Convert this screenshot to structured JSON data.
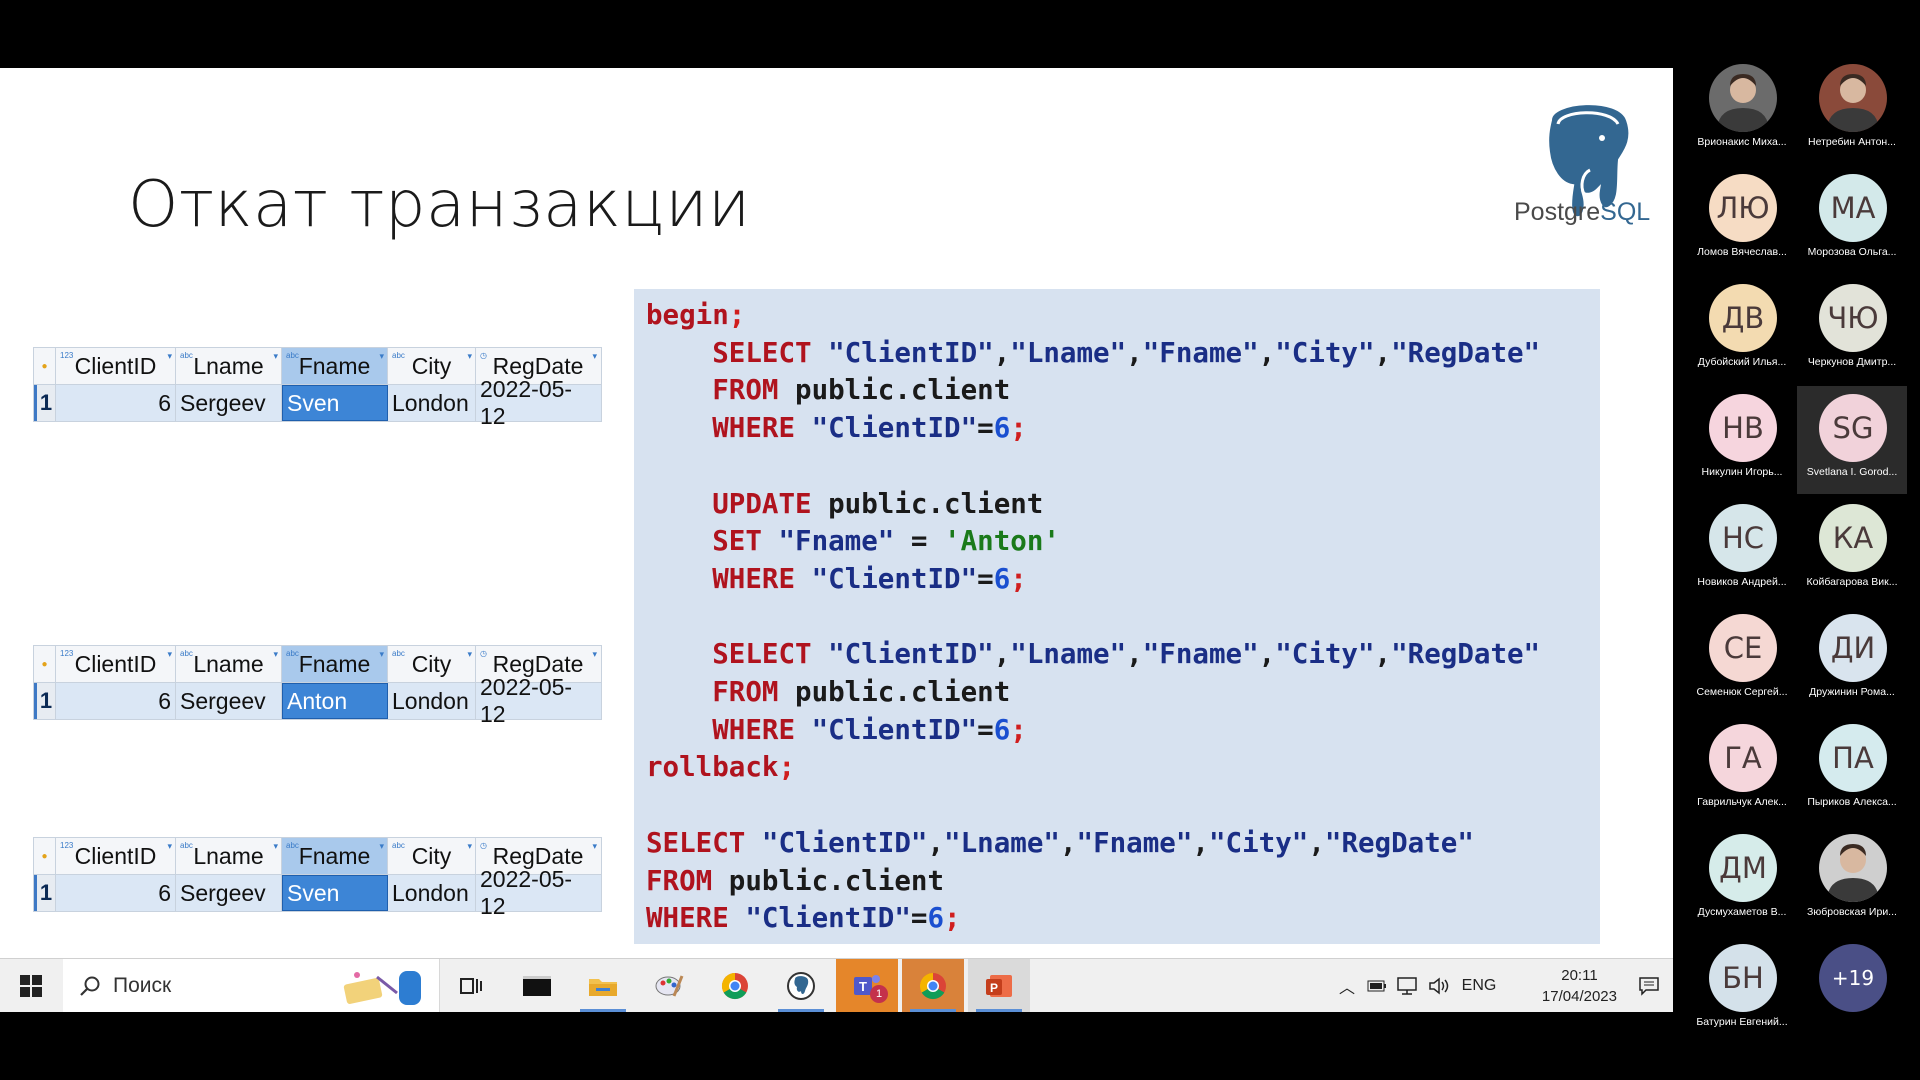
{
  "slide": {
    "title": "Откат транзакции",
    "logo": {
      "word_a": "Postgre",
      "word_b": "SQL"
    },
    "grids": [
      {
        "headers": [
          "ClientID",
          "Lname",
          "Fname",
          "City",
          "RegDate"
        ],
        "row_no": "1",
        "row": [
          "6",
          "Sergeev",
          "Sven",
          "London",
          "2022-05-12"
        ]
      },
      {
        "headers": [
          "ClientID",
          "Lname",
          "Fname",
          "City",
          "RegDate"
        ],
        "row_no": "1",
        "row": [
          "6",
          "Sergeev",
          "Anton",
          "London",
          "2022-05-12"
        ]
      },
      {
        "headers": [
          "ClientID",
          "Lname",
          "Fname",
          "City",
          "RegDate"
        ],
        "row_no": "1",
        "row": [
          "6",
          "Sergeev",
          "Sven",
          "London",
          "2022-05-12"
        ]
      }
    ],
    "code_lines": [
      [
        [
          "begin",
          "kw"
        ],
        [
          ";",
          "semi"
        ]
      ],
      [
        [
          "    SELECT ",
          "kw"
        ],
        [
          "\"ClientID\"",
          "str"
        ],
        [
          ",",
          ""
        ],
        [
          "\"Lname\"",
          "str"
        ],
        [
          ",",
          ""
        ],
        [
          "\"Fname\"",
          "str"
        ],
        [
          ",",
          ""
        ],
        [
          "\"City\"",
          "str"
        ],
        [
          ",",
          ""
        ],
        [
          "\"RegDate\"",
          "str"
        ]
      ],
      [
        [
          "    FROM ",
          "kw"
        ],
        [
          "public.client",
          ""
        ]
      ],
      [
        [
          "    WHERE ",
          "kw"
        ],
        [
          "\"ClientID\"",
          "str"
        ],
        [
          "=",
          ""
        ],
        [
          "6",
          "num2"
        ],
        [
          ";",
          "semi"
        ]
      ],
      [
        [
          "",
          ""
        ]
      ],
      [
        [
          "    UPDATE ",
          "kw"
        ],
        [
          "public.client",
          ""
        ]
      ],
      [
        [
          "    SET ",
          "kw"
        ],
        [
          "\"Fname\"",
          "str"
        ],
        [
          " = ",
          ""
        ],
        [
          "'Anton'",
          "lit"
        ]
      ],
      [
        [
          "    WHERE ",
          "kw"
        ],
        [
          "\"ClientID\"",
          "str"
        ],
        [
          "=",
          ""
        ],
        [
          "6",
          "num2"
        ],
        [
          ";",
          "semi"
        ]
      ],
      [
        [
          "",
          ""
        ]
      ],
      [
        [
          "    SELECT ",
          "kw"
        ],
        [
          "\"ClientID\"",
          "str"
        ],
        [
          ",",
          ""
        ],
        [
          "\"Lname\"",
          "str"
        ],
        [
          ",",
          ""
        ],
        [
          "\"Fname\"",
          "str"
        ],
        [
          ",",
          ""
        ],
        [
          "\"City\"",
          "str"
        ],
        [
          ",",
          ""
        ],
        [
          "\"RegDate\"",
          "str"
        ]
      ],
      [
        [
          "    FROM ",
          "kw"
        ],
        [
          "public.client",
          ""
        ]
      ],
      [
        [
          "    WHERE ",
          "kw"
        ],
        [
          "\"ClientID\"",
          "str"
        ],
        [
          "=",
          ""
        ],
        [
          "6",
          "num2"
        ],
        [
          ";",
          "semi"
        ]
      ],
      [
        [
          "rollback",
          "kw"
        ],
        [
          ";",
          "semi"
        ]
      ],
      [
        [
          "",
          ""
        ]
      ],
      [
        [
          "SELECT ",
          "kw"
        ],
        [
          "\"ClientID\"",
          "str"
        ],
        [
          ",",
          ""
        ],
        [
          "\"Lname\"",
          "str"
        ],
        [
          ",",
          ""
        ],
        [
          "\"Fname\"",
          "str"
        ],
        [
          ",",
          ""
        ],
        [
          "\"City\"",
          "str"
        ],
        [
          ",",
          ""
        ],
        [
          "\"RegDate\"",
          "str"
        ]
      ],
      [
        [
          "FROM ",
          "kw"
        ],
        [
          "public.client",
          ""
        ]
      ],
      [
        [
          "WHERE ",
          "kw"
        ],
        [
          "\"ClientID\"",
          "str"
        ],
        [
          "=",
          ""
        ],
        [
          "6",
          "num2"
        ],
        [
          ";",
          "semi"
        ]
      ]
    ]
  },
  "taskbar": {
    "search_placeholder": "Поиск",
    "apps": [
      "task-view-icon",
      "terminal-icon",
      "file-explorer-icon",
      "paint-icon",
      "chrome-icon",
      "pgadmin-icon",
      "teams-icon",
      "chrome-icon",
      "powerpoint-icon"
    ],
    "teams_badge": "1",
    "lang": "ENG",
    "time": "20:11",
    "date": "17/04/2023"
  },
  "participants": [
    {
      "initials": "",
      "name": "Врионакис Миха...",
      "photo": true,
      "color": "#6b6b6b"
    },
    {
      "initials": "",
      "name": "Нетребин Антон...",
      "photo": true,
      "color": "#8a4a3a"
    },
    {
      "initials": "ЛЮ",
      "name": "Ломов Вячеслав...",
      "color": "#f6dcc4"
    },
    {
      "initials": "МА",
      "name": "Морозова Ольга...",
      "color": "#d3e9ea"
    },
    {
      "initials": "ДВ",
      "name": "Дубойский Илья...",
      "color": "#f3dbb1"
    },
    {
      "initials": "ЧЮ",
      "name": "Черкунов Дмитр...",
      "color": "#e2e3d9"
    },
    {
      "initials": "НВ",
      "name": "Никулин Игорь...",
      "color": "#f6d5de"
    },
    {
      "initials": "SG",
      "name": "Svetlana I. Gorod...",
      "color": "#f1d2da",
      "highlight": true
    },
    {
      "initials": "НС",
      "name": "Новиков Андрей...",
      "color": "#d6e6ea"
    },
    {
      "initials": "КА",
      "name": "Койбагарова Вик...",
      "color": "#dde7d6"
    },
    {
      "initials": "СЕ",
      "name": "Семенюк Сергей...",
      "color": "#f5d8d3"
    },
    {
      "initials": "ДИ",
      "name": "Дружинин Рома...",
      "color": "#d9e4ee"
    },
    {
      "initials": "ГА",
      "name": "Гаврильчук Алек...",
      "color": "#f5d6dc"
    },
    {
      "initials": "ПА",
      "name": "Пыриков Алекса...",
      "color": "#d5ebee"
    },
    {
      "initials": "ДМ",
      "name": "Дусмухаметов В...",
      "color": "#d6ecea"
    },
    {
      "initials": "",
      "name": "Зюбровская Ири...",
      "photo": true,
      "color": "#cfcfcf"
    },
    {
      "initials": "БН",
      "name": "Батурин Евгений...",
      "color": "#d4e1ea"
    },
    {
      "initials": "+19",
      "name": "",
      "color": "#4a4f86",
      "more": true
    }
  ]
}
